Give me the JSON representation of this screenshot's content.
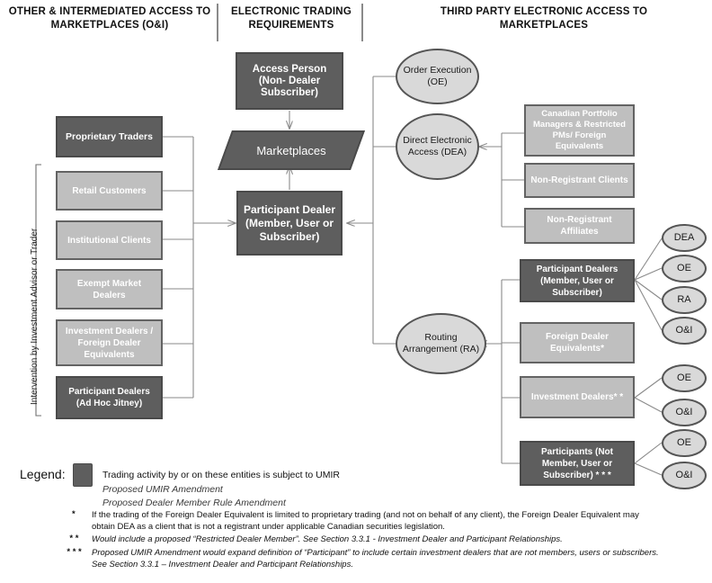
{
  "headers": {
    "left": "OTHER & INTERMEDIATED ACCESS TO MARKETPLACES (O&I)",
    "center": "ELECTRONIC TRADING REQUIREMENTS",
    "right": "THIRD PARTY ELECTRONIC ACCESS TO MARKETPLACES"
  },
  "center_column": {
    "access_person": "Access Person (Non- Dealer Subscriber)",
    "marketplaces": "Marketplaces",
    "participant_dealer": "Participant Dealer (Member, User or Subscriber)"
  },
  "left_column": {
    "vertical_label": "Intervention by Investment Advisor or Trader",
    "boxes": [
      {
        "label": "Proprietary Traders",
        "umir": true
      },
      {
        "label": "Retail Customers",
        "umir": false
      },
      {
        "label": "Institutional Clients",
        "umir": false
      },
      {
        "label": "Exempt Market Dealers",
        "umir": false
      },
      {
        "label": "Investment Dealers / Foreign Dealer Equivalents",
        "umir": false
      },
      {
        "label": "Participant Dealers (Ad Hoc Jitney)",
        "umir": true
      }
    ]
  },
  "access_modes": [
    {
      "label": "Order Execution (OE)",
      "abbr": "OE"
    },
    {
      "label": "Direct Electronic Access (DEA)",
      "abbr": "DEA"
    },
    {
      "label": "Routing Arrangement (RA)",
      "abbr": "RA"
    }
  ],
  "dea_clients": [
    {
      "label": "Canadian Portfolio Managers & Restricted PMs/ Foreign Equivalents",
      "umir": false
    },
    {
      "label": "Non-Registrant Clients",
      "umir": false
    },
    {
      "label": "Non-Registrant Affiliates",
      "umir": false
    }
  ],
  "ra_clients": [
    {
      "label": "Participant Dealers (Member, User  or Subscriber)",
      "umir": true,
      "modes": [
        "DEA",
        "OE",
        "RA",
        "O&I"
      ]
    },
    {
      "label": "Foreign Dealer Equivalents*",
      "umir": false,
      "modes": []
    },
    {
      "label": "Investment Dealers* *",
      "umir": false,
      "modes": [
        "OE",
        "O&I"
      ]
    },
    {
      "label": "Participants (Not Member, User or Subscriber)  * * *",
      "umir": true,
      "modes": [
        "OE",
        "O&I"
      ]
    }
  ],
  "legend": {
    "title": "Legend:",
    "swatch_color": "#5e5e5e",
    "lines": [
      {
        "text": "Trading activity by or on these entities is subject to UMIR",
        "italic": false
      },
      {
        "text": "Proposed UMIR Amendment",
        "italic": true
      },
      {
        "text": "Proposed Dealer Member Rule Amendment",
        "italic": true
      }
    ]
  },
  "footnotes": [
    {
      "mark": "*",
      "italic": false,
      "line1": "If the trading of the Foreign Dealer Equivalent is limited to proprietary trading (and not on behalf of any client), the Foreign Dealer Equivalent may",
      "line2": "obtain DEA as a client that is not a registrant under applicable Canadian securities legislation."
    },
    {
      "mark": "* *",
      "italic": true,
      "line1": "Would include a proposed “Restricted Dealer Member”.  See Section 3.3.1 - Investment Dealer and Participant Relationships.",
      "line2": ""
    },
    {
      "mark": "* * *",
      "italic": true,
      "line1": "Proposed UMIR Amendment would expand definition of “Participant” to include certain investment dealers that are not members, users or subscribers.",
      "line2": "See Section 3.3.1 – Investment Dealer and Participant Relationships."
    }
  ]
}
